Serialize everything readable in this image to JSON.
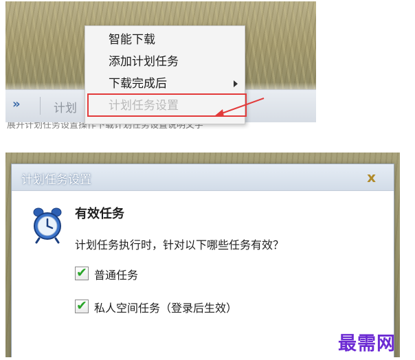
{
  "top": {
    "taskbar": {
      "expand_glyph": "»",
      "label_partial": "计划"
    },
    "under_text": "展开计划任务设置操作下载计划任务设置说明文字",
    "context_menu": {
      "items": [
        {
          "label": "智能下载"
        },
        {
          "label": "添加计划任务"
        },
        {
          "label": "下载完成后",
          "has_submenu": true
        },
        {
          "label": "计划任务设置",
          "disabled": true
        }
      ]
    },
    "highlight_color": "#e23a3a"
  },
  "dialog": {
    "title": "计划任务设置",
    "close_label": "x",
    "icon": "alarm-clock-icon",
    "heading": "有效任务",
    "description": "计划任务执行时，针对以下哪些任务有效？",
    "options": [
      {
        "label": "普通任务",
        "checked": true
      },
      {
        "label": "私人空间任务（登录后生效）",
        "checked": true
      }
    ]
  },
  "watermark": "最需网",
  "colors": {
    "accent_check": "#2aa52a",
    "close_icon": "#b08a2a",
    "watermark": "#6c2bd3"
  }
}
